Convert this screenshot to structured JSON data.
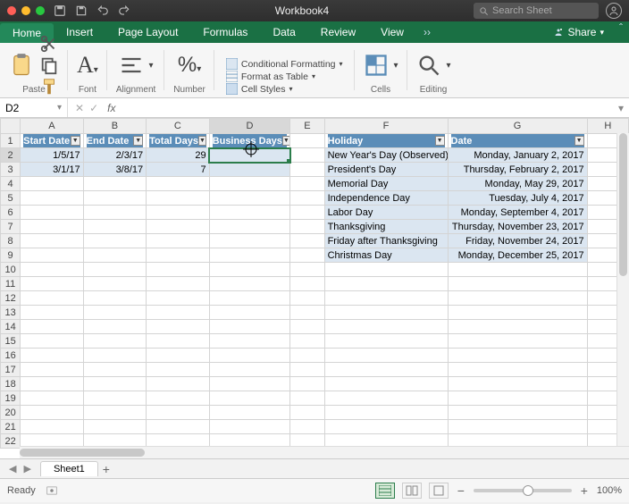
{
  "titlebar": {
    "title": "Workbook4",
    "search_placeholder": "Search Sheet"
  },
  "ribbon_tabs": {
    "active": "Home",
    "items": [
      "Home",
      "Insert",
      "Page Layout",
      "Formulas",
      "Data",
      "Review",
      "View"
    ],
    "share_label": "Share"
  },
  "ribbon_groups": {
    "paste": "Paste",
    "font": "Font",
    "alignment": "Alignment",
    "number": "Number",
    "cond_fmt": "Conditional Formatting",
    "fmt_table": "Format as Table",
    "cell_styles": "Cell Styles",
    "cells": "Cells",
    "editing": "Editing"
  },
  "formula_bar": {
    "name_box": "D2",
    "fx": "fx",
    "formula": ""
  },
  "columns": [
    "A",
    "B",
    "C",
    "D",
    "E",
    "F",
    "G",
    "H"
  ],
  "row_count": 22,
  "left_table": {
    "headers": [
      "Start Date",
      "End Date",
      "Total Days",
      "Business Days"
    ],
    "rows": [
      {
        "start": "1/5/17",
        "end": "2/3/17",
        "total": "29",
        "business": ""
      },
      {
        "start": "3/1/17",
        "end": "3/8/17",
        "total": "7",
        "business": ""
      }
    ]
  },
  "right_table": {
    "headers": [
      "Holiday",
      "Date"
    ],
    "rows": [
      {
        "holiday": "New Year's Day (Observed)",
        "date": "Monday, January 2, 2017"
      },
      {
        "holiday": "President's Day",
        "date": "Thursday, February 2, 2017"
      },
      {
        "holiday": "Memorial Day",
        "date": "Monday, May 29, 2017"
      },
      {
        "holiday": "Independence Day",
        "date": "Tuesday, July 4, 2017"
      },
      {
        "holiday": "Labor Day",
        "date": "Monday, September 4, 2017"
      },
      {
        "holiday": "Thanksgiving",
        "date": "Thursday, November 23, 2017"
      },
      {
        "holiday": "Friday after Thanksgiving",
        "date": "Friday, November 24, 2017"
      },
      {
        "holiday": "Christmas Day",
        "date": "Monday, December 25, 2017"
      }
    ]
  },
  "sheet_tabs": {
    "active": "Sheet1"
  },
  "status_bar": {
    "ready": "Ready",
    "zoom": "100%"
  },
  "selected_cell": "D2"
}
